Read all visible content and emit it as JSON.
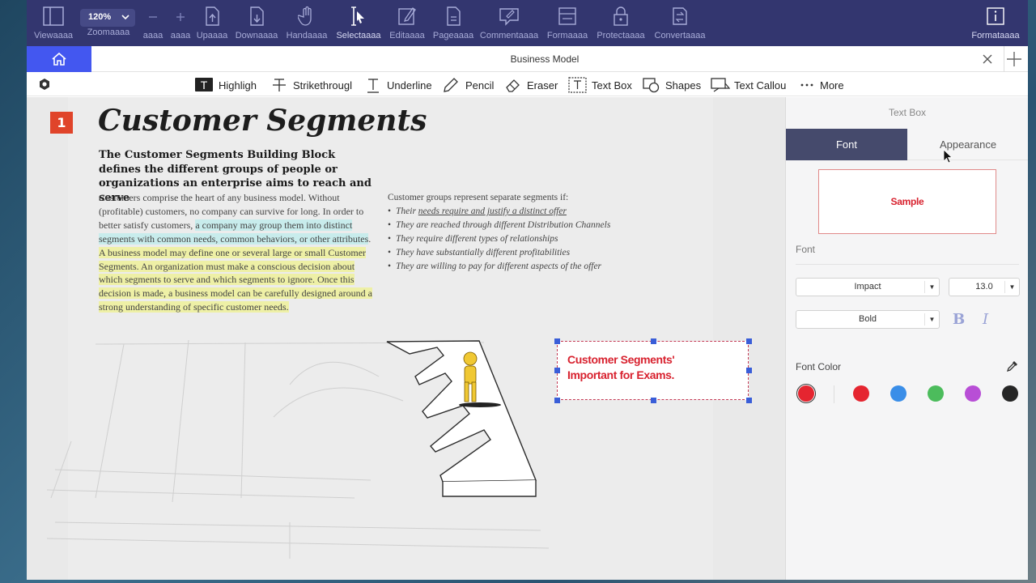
{
  "toolbar": {
    "zoom_value": "120%",
    "items": [
      {
        "label": "Viewaaaa",
        "icon": "sidebar-icon"
      },
      {
        "label": "Zoomaaaa",
        "icon": "zoom-icon"
      },
      {
        "label": "aaaa",
        "icon": "zoom-out-icon"
      },
      {
        "label": "aaaa",
        "icon": "zoom-in-icon"
      },
      {
        "label": "Upaaaa",
        "icon": "page-up-icon"
      },
      {
        "label": "Downaaaa",
        "icon": "page-down-icon"
      },
      {
        "label": "Handaaaa",
        "icon": "hand-icon"
      },
      {
        "label": "Selectaaaa",
        "icon": "select-cursor-icon"
      },
      {
        "label": "Editaaaa",
        "icon": "edit-icon"
      },
      {
        "label": "Pageaaaa",
        "icon": "page-icon"
      },
      {
        "label": "Commentaaaa",
        "icon": "comment-icon"
      },
      {
        "label": "Formaaaa",
        "icon": "form-icon"
      },
      {
        "label": "Protectaaaa",
        "icon": "lock-icon"
      },
      {
        "label": "Convertaaaa",
        "icon": "convert-icon"
      },
      {
        "label": "Formataaaa",
        "icon": "info-icon"
      }
    ]
  },
  "tab": {
    "title": "Business Model"
  },
  "annotation_tools": [
    {
      "label": "Highligh",
      "icon": "highlight-icon"
    },
    {
      "label": "Strikethrougl",
      "icon": "strikethrough-icon"
    },
    {
      "label": "Underline",
      "icon": "underline-icon"
    },
    {
      "label": "Pencil",
      "icon": "pencil-icon"
    },
    {
      "label": "Eraser",
      "icon": "eraser-icon"
    },
    {
      "label": "Text Box",
      "icon": "text-box-icon"
    },
    {
      "label": "Shapes",
      "icon": "shapes-icon"
    },
    {
      "label": "Text Callou",
      "icon": "text-callout-icon"
    },
    {
      "label": "More",
      "icon": "more-icon"
    }
  ],
  "document": {
    "badge": "1",
    "title": "Customer Segments",
    "subtitle": "The Customer Segments Building Block defines the different groups of people or organizations an enterprise aims to reach and serve",
    "body_plain": "Customers comprise the heart of any business model. Without (profitable) customers, no company can survive for long. In order to better satisfy customers, ",
    "body_cyan": "a company may group them into distinct segments with common needs, common behaviors, or other attributes",
    "body_dot": ".",
    "body_yellow": " A business model may define one or several large or small Customer Segments. An organization must make a conscious decision about which segments to serve and which segments to ignore. Once this decision is made, a business model can be carefully designed around a strong understanding of specific customer needs.",
    "right_intro": "Customer groups represent separate segments if:",
    "bullet1_pre": "Their ",
    "bullet1_ul": "needs require and justify a distinct offer",
    "bullets": [
      "They are reached through different Distribution Channels",
      "They require different types of relationships",
      "They have substantially different profitabilities",
      "They are willing to pay for different aspects of the offer"
    ],
    "textbox_line1": "Customer Segments'",
    "textbox_line2": "Important for Exams."
  },
  "panel": {
    "title": "Text Box",
    "tab_font": "Font",
    "tab_appearance": "Appearance",
    "sample": "Sample",
    "font_section": "Font",
    "font_family": "Impact",
    "font_size": "13.0",
    "font_weight": "Bold",
    "bold_label": "B",
    "italic_label": "I",
    "font_color_label": "Font Color",
    "colors": [
      "#e52530",
      "#e52530",
      "#3a8ee8",
      "#4cbc5c",
      "#b84ed6",
      "#262626"
    ],
    "accent": "#4357f0"
  }
}
